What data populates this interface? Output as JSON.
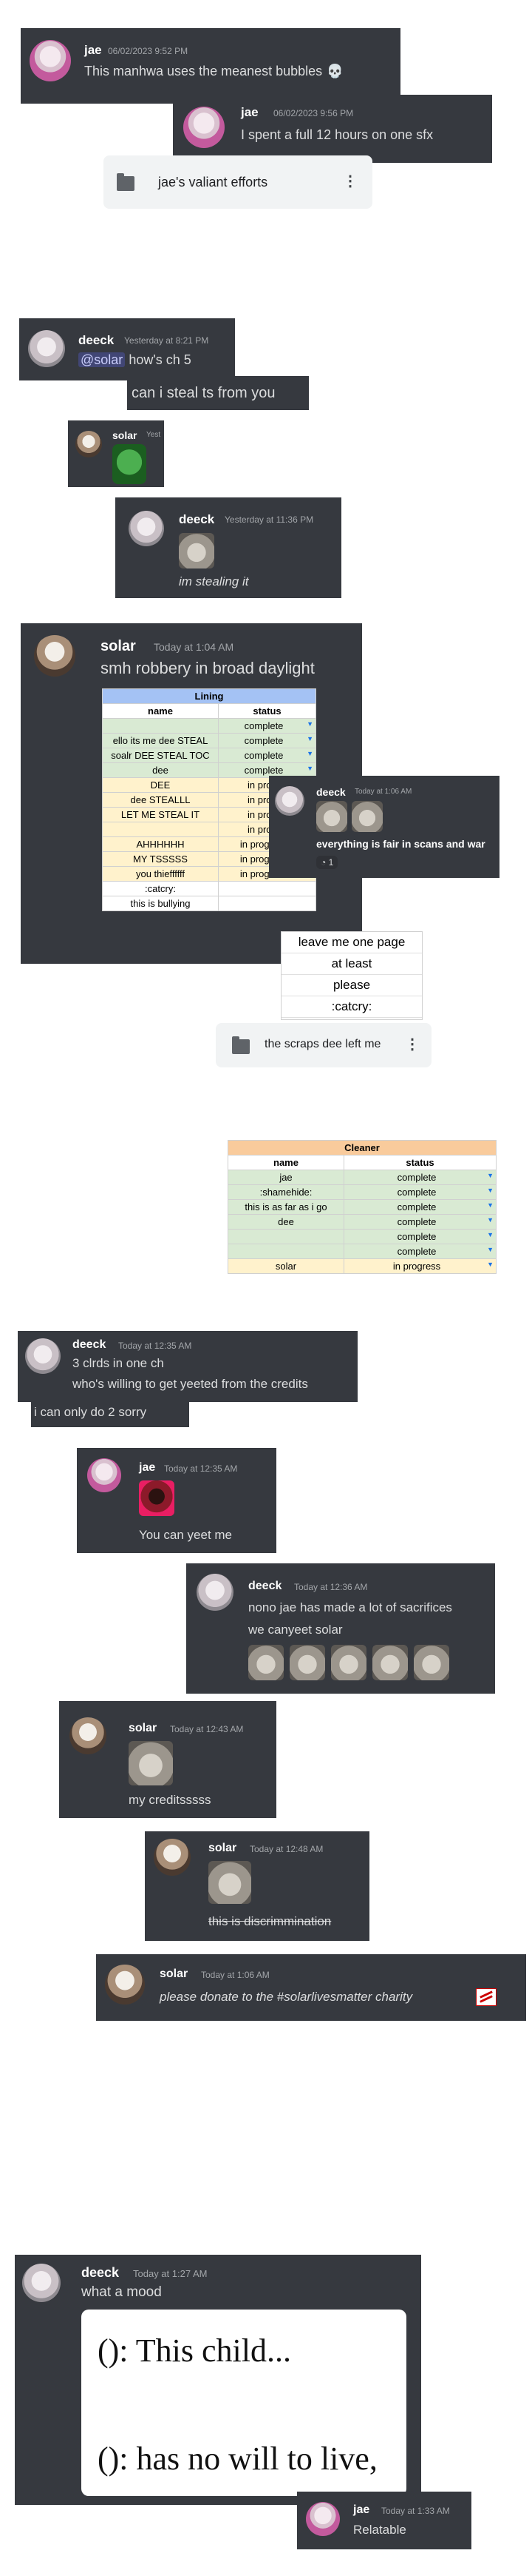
{
  "m1": {
    "user": "jae",
    "ts": "06/02/2023 9:52 PM",
    "text": "This manhwa uses the meanest bubbles",
    "emoji": "💀"
  },
  "m2": {
    "user": "jae",
    "ts": "06/02/2023 9:56 PM",
    "text": "I spent a full 12 hours on one sfx"
  },
  "file1": {
    "name": "jae's valiant efforts"
  },
  "m3": {
    "user": "deeck",
    "ts": "Yesterday at 8:21 PM",
    "mention": "@solar",
    "text": "how's ch 5"
  },
  "m4": {
    "text": "can i steal ts from you"
  },
  "m5": {
    "user": "solar",
    "ts": "Yest"
  },
  "m6": {
    "user": "deeck",
    "ts": "Yesterday at 11:36 PM",
    "text": "im stealing it"
  },
  "m7": {
    "user": "solar",
    "ts": "Today at 1:04 AM",
    "text": "smh robbery in broad daylight"
  },
  "lining": {
    "title": "Lining",
    "headers": [
      "name",
      "status"
    ],
    "rows": [
      [
        "",
        "complete"
      ],
      [
        "ello its me dee STEAL",
        "complete"
      ],
      [
        "soalr DEE STEAL TOC",
        "complete"
      ],
      [
        "dee",
        "complete"
      ],
      [
        "DEE",
        "in progr"
      ],
      [
        "dee STEALLL",
        "in progr"
      ],
      [
        "LET ME STEAL IT",
        "in progr"
      ],
      [
        "",
        "in progr"
      ],
      [
        "AHHHHHH",
        "in progress"
      ],
      [
        "MY TSSSSS",
        "in progress"
      ],
      [
        "you thieffffff",
        "in progress"
      ],
      [
        ":catcry:",
        ""
      ],
      [
        "this is bullying",
        ""
      ]
    ]
  },
  "m8": {
    "user": "deeck",
    "ts": "Today at 1:06 AM",
    "text": "everything is fair in scans and war",
    "reaction": "1"
  },
  "tags": [
    "leave me one page",
    "at least",
    "please",
    ":catcry:"
  ],
  "file2": {
    "name": "the scraps dee left me"
  },
  "cleaner": {
    "title": "Cleaner",
    "headers": [
      "name",
      "status"
    ],
    "rows": [
      [
        "jae",
        "complete"
      ],
      [
        ":shamehide:",
        "complete"
      ],
      [
        "this is as far as i go",
        "complete"
      ],
      [
        "dee",
        "complete"
      ],
      [
        "",
        "complete"
      ],
      [
        "",
        "complete"
      ],
      [
        "solar",
        "in progress"
      ]
    ]
  },
  "m9": {
    "user": "deeck",
    "ts": "Today at 12:35 AM",
    "text1": "3 clrds in one ch",
    "text2": "who's willing to get yeeted from the credits",
    "text3": "i can only do 2 sorry"
  },
  "m10": {
    "user": "jae",
    "ts": "Today at 12:35 AM",
    "text": "You can yeet me"
  },
  "m11": {
    "user": "deeck",
    "ts": "Today at 12:36 AM",
    "text1": "nono jae has made a lot of sacrifices",
    "text2": "we canyeet solar"
  },
  "m12": {
    "user": "solar",
    "ts": "Today at 12:43 AM",
    "text": "my creditsssss"
  },
  "m13": {
    "user": "solar",
    "ts": "Today at 12:48 AM",
    "text": "this is discrimmination"
  },
  "m14": {
    "user": "solar",
    "ts": "Today at 1:06 AM",
    "text": "please donate to the #solarlivesmatter charity"
  },
  "m15": {
    "user": "deeck",
    "ts": "Today at 1:27 AM",
    "text": "what a mood",
    "meme1": "(): This child...",
    "meme2": "(): has no will to live,"
  },
  "m16": {
    "user": "jae",
    "ts": "Today at 1:33 AM",
    "text": "Relatable"
  }
}
